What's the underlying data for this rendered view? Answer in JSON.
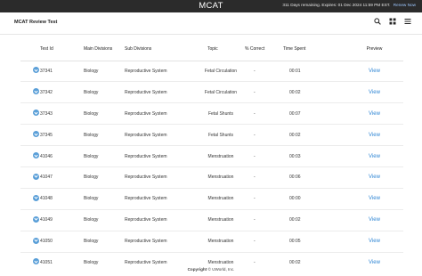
{
  "topbar": {
    "brand": "MCAT",
    "expiry": "311 Days remaining. Expires: 01 Dec 2024 11:59 PM EST.",
    "renew": "Renew Now"
  },
  "header": {
    "title": "MCAT Review Test",
    "icons": [
      "search-icon",
      "grid-icon",
      "menu-icon"
    ]
  },
  "table": {
    "columns": [
      "Test Id",
      "Main Divisions",
      "Sub Divisions",
      "Topic",
      "% Correct",
      "Time Spent",
      "Preview"
    ],
    "rows": [
      {
        "id": "37341",
        "division": "Biology",
        "sub": "Reproductive System",
        "topic": "Fetal Circulation",
        "correct": "-",
        "time": "00:01",
        "preview": "View"
      },
      {
        "id": "37342",
        "division": "Biology",
        "sub": "Reproductive System",
        "topic": "Fetal Circulation",
        "correct": "-",
        "time": "00:02",
        "preview": "View"
      },
      {
        "id": "37343",
        "division": "Biology",
        "sub": "Reproductive System",
        "topic": "Fetal Shunts",
        "correct": "-",
        "time": "00:07",
        "preview": "View"
      },
      {
        "id": "37345",
        "division": "Biology",
        "sub": "Reproductive System",
        "topic": "Fetal Shunts",
        "correct": "-",
        "time": "00:02",
        "preview": "View"
      },
      {
        "id": "41046",
        "division": "Biology",
        "sub": "Reproductive System",
        "topic": "Menstruation",
        "correct": "-",
        "time": "00:03",
        "preview": "View"
      },
      {
        "id": "41047",
        "division": "Biology",
        "sub": "Reproductive System",
        "topic": "Menstruation",
        "correct": "-",
        "time": "00:06",
        "preview": "View"
      },
      {
        "id": "41048",
        "division": "Biology",
        "sub": "Reproductive System",
        "topic": "Menstruation",
        "correct": "-",
        "time": "00:00",
        "preview": "View"
      },
      {
        "id": "41049",
        "division": "Biology",
        "sub": "Reproductive System",
        "topic": "Menstruation",
        "correct": "-",
        "time": "00:02",
        "preview": "View"
      },
      {
        "id": "41050",
        "division": "Biology",
        "sub": "Reproductive System",
        "topic": "Menstruation",
        "correct": "-",
        "time": "00:05",
        "preview": "View"
      },
      {
        "id": "41051",
        "division": "Biology",
        "sub": "Reproductive System",
        "topic": "Menstruation",
        "correct": "-",
        "time": "00:02",
        "preview": "View"
      }
    ]
  },
  "footer": {
    "label": "Copyright",
    "text": "© UWorld, Inc."
  },
  "colors": {
    "topbar": "#2b2b2b",
    "accent": "#2f86d4",
    "expand_button": "#5a9fd8"
  }
}
